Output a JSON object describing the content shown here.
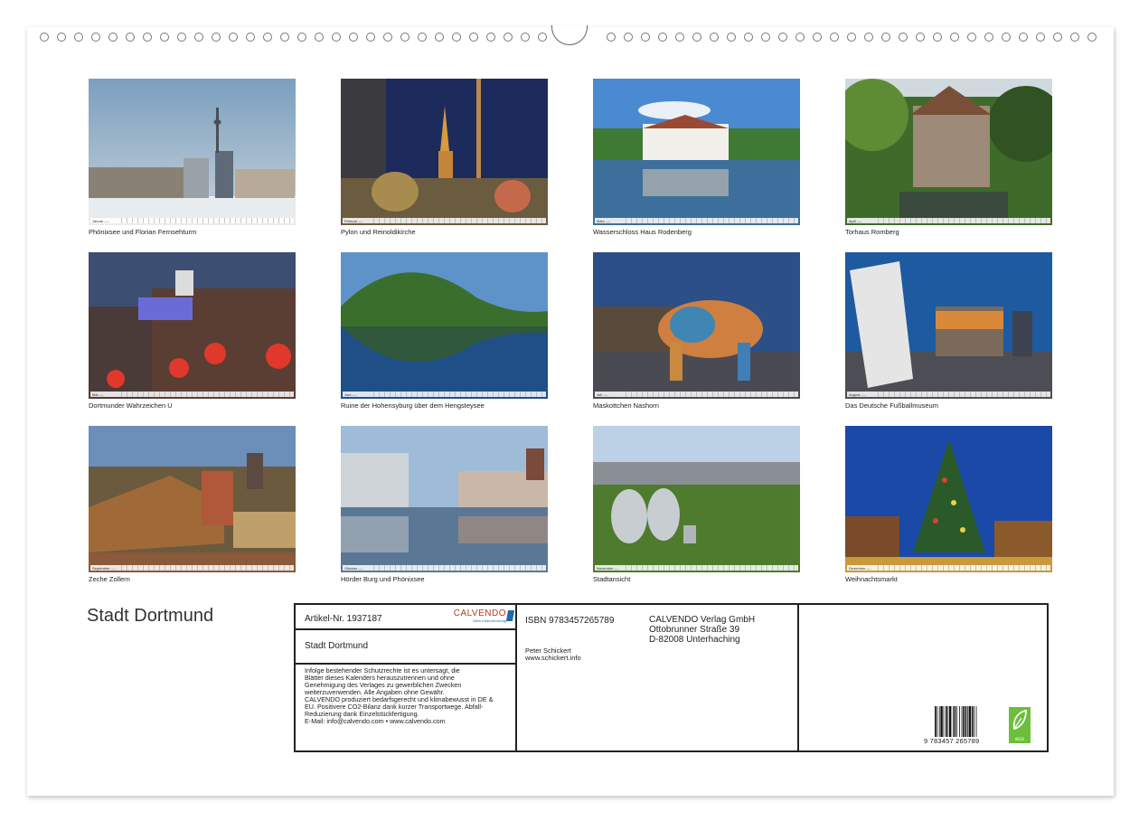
{
  "product": {
    "title": "Stadt Dortmund",
    "article_label": "Artikel-Nr. 1937187",
    "brand": "CALVENDO",
    "brand_tagline": "Mein Kalenderverlag",
    "name": "Stadt Dortmund",
    "legal_lines": [
      "Infolge bestehender Schutzrechte ist es untersagt, die",
      "Blätter dieses Kalenders herauszutrennen und ohne",
      "Genehmigung des Verlages zu gewerblichen Zwecken",
      "weiterzuverwenden. Alle Angaben ohne Gewähr.",
      "CALVENDO produziert bedarfsgerecht und klimabewusst in DE &",
      "EU. Positivere CO2-Bilanz dank kurzer Transportwege. Abfall-",
      "Reduzierung dank Einzelstückfertigung.",
      "E-Mail: info@calvendo.com • www.calvendo.com"
    ],
    "isbn": "ISBN 9783457265789",
    "publisher_lines": [
      "CALVENDO Verlag GmbH",
      "Ottobrunner Straße 39",
      "D-82008 Unterhaching"
    ],
    "author_lines": [
      "Peter Schickert",
      "www.schickert.info"
    ],
    "barcode_digits": "9   783457   265789",
    "eco_label": "eco"
  },
  "months": [
    {
      "month": "Januar ----",
      "caption": "Phönixsee und Florian Fernsehturm"
    },
    {
      "month": "Februar ----",
      "caption": "Pylon und Reinoldikirche"
    },
    {
      "month": "März ----",
      "caption": "Wasserschloss Haus Rodenberg"
    },
    {
      "month": "April ----",
      "caption": "Torhaus Romberg"
    },
    {
      "month": "Mai ----",
      "caption": "Dortmunder Wahrzeichen U"
    },
    {
      "month": "Juni ----",
      "caption": "Ruine der Hohensyburg über dem Hengsteysee"
    },
    {
      "month": "Juli ----",
      "caption": "Maskottchen Nashorn"
    },
    {
      "month": "August ----",
      "caption": "Das Deutsche Fußballmuseum"
    },
    {
      "month": "September ----",
      "caption": "Zeche Zollern"
    },
    {
      "month": "Oktober ----",
      "caption": "Hörder Burg und Phönixsee"
    },
    {
      "month": "November ----",
      "caption": "Stadtansicht"
    },
    {
      "month": "Dezember ----",
      "caption": "Weihnachtsmarkt"
    }
  ],
  "colors": {
    "brand_red": "#b23a1e",
    "brand_blue": "#1e6aa8",
    "eco_green": "#6bbf3b"
  }
}
